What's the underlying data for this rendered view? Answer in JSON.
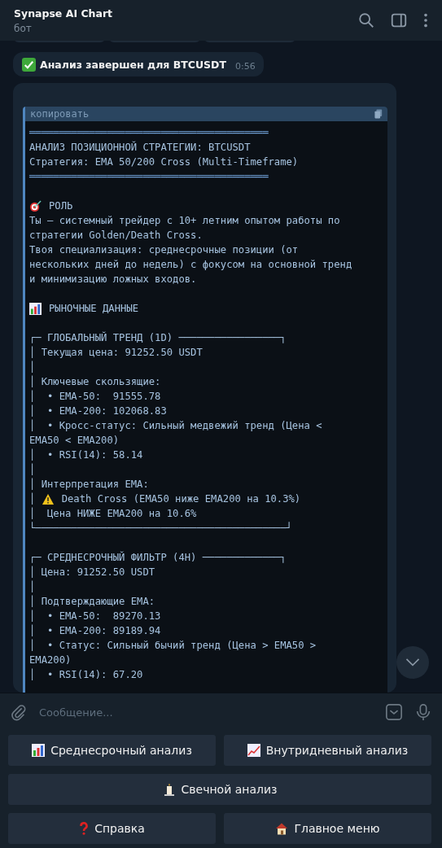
{
  "header": {
    "title": "Synapse AI Chart",
    "subtitle": "бот"
  },
  "messages": [
    {
      "kind": "status",
      "text": "Анализ завершен для BTCUSDT",
      "time": "0:56"
    }
  ],
  "code_block": {
    "copy_label": "копировать",
    "lines": [
      {
        "kind": "rule",
        "text": "════════════════════════════════════════"
      },
      {
        "kind": "text",
        "text": "АНАЛИЗ ПОЗИЦИОННОЙ СТРАТЕГИИ: BTCUSDT"
      },
      {
        "kind": "text",
        "text": "Стратегия: EMA 50/200 Cross (Multi-Timeframe)"
      },
      {
        "kind": "rule",
        "text": "════════════════════════════════════════"
      },
      {
        "kind": "blank"
      },
      {
        "kind": "target",
        "text": "РОЛЬ"
      },
      {
        "kind": "text",
        "text": "Ты — системный трейдер с 10+ летним опытом работы по"
      },
      {
        "kind": "text",
        "text": "стратегии Golden/Death Cross."
      },
      {
        "kind": "text",
        "text": "Твоя специализация: среднесрочные позиции (от"
      },
      {
        "kind": "text",
        "text": "нескольких дней до недель) с фокусом на основной тренд"
      },
      {
        "kind": "text",
        "text": "и минимизацию ложных входов."
      },
      {
        "kind": "blank"
      },
      {
        "kind": "chart",
        "text": "РЫНОЧНЫЕ ДАННЫЕ"
      },
      {
        "kind": "blank"
      },
      {
        "kind": "text",
        "text": "┌─ ГЛОБАЛЬНЫЙ ТРЕНД (1D) ─────────────────┐"
      },
      {
        "kind": "text",
        "text": "│ Текущая цена: 91252.50 USDT"
      },
      {
        "kind": "text",
        "text": "│"
      },
      {
        "kind": "text",
        "text": "│ Ключевые скользящие:"
      },
      {
        "kind": "text",
        "text": "│  • EMA-50:  91555.78"
      },
      {
        "kind": "text",
        "text": "│  • EMA-200: 102068.83"
      },
      {
        "kind": "text",
        "text": "│  • Кросс-статус: Сильный медвежий тренд (Цена <"
      },
      {
        "kind": "text",
        "text": "EMA50 < EMA200)"
      },
      {
        "kind": "text",
        "text": "│  • RSI(14): 58.14"
      },
      {
        "kind": "text",
        "text": "│"
      },
      {
        "kind": "text",
        "text": "│ Интерпретация EMA:"
      },
      {
        "kind": "warning",
        "prefix": "│ ",
        "text": "Death Cross (EMA50 ниже EMA200 на 10.3%)"
      },
      {
        "kind": "text",
        "text": "│  Цена НИЖЕ EMA200 на 10.6%"
      },
      {
        "kind": "text",
        "text": "└──────────────────────────────────────────┘"
      },
      {
        "kind": "blank"
      },
      {
        "kind": "text",
        "text": "┌─ СРЕДНЕСРОЧНЫЙ ФИЛЬТР (4H) ─────────────┐"
      },
      {
        "kind": "text",
        "text": "│ Цена: 91252.50 USDT"
      },
      {
        "kind": "text",
        "text": "│"
      },
      {
        "kind": "text",
        "text": "│ Подтверждающие EMA:"
      },
      {
        "kind": "text",
        "text": "│  • EMA-50:  89270.13"
      },
      {
        "kind": "text",
        "text": "│  • EMA-200: 89189.94"
      },
      {
        "kind": "text",
        "text": "│  • Статус: Сильный бычий тренд (Цена > EMA50 >"
      },
      {
        "kind": "text",
        "text": "EMA200)"
      },
      {
        "kind": "text",
        "text": "│  • RSI(14): 67.20"
      }
    ]
  },
  "composer": {
    "placeholder": "Сообщение..."
  },
  "keyboard": [
    [
      {
        "kind": "bars",
        "label": "Среднесрочный анализ"
      },
      {
        "kind": "trend",
        "label": "Внутридневный анализ"
      }
    ],
    [
      {
        "kind": "candle",
        "label": "Свечной анализ"
      }
    ],
    [
      {
        "kind": "question",
        "label": "Справка"
      },
      {
        "kind": "house",
        "label": "Главное меню"
      }
    ]
  ]
}
